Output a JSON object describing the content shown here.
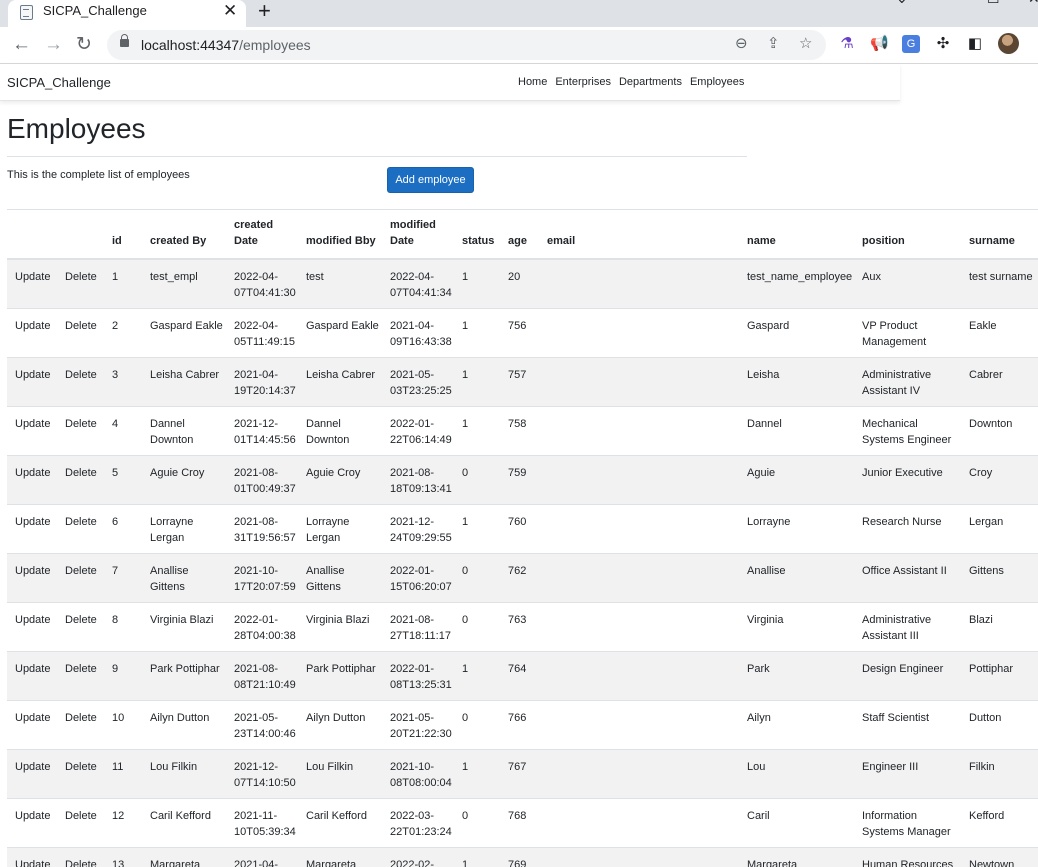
{
  "browser": {
    "tab_title": "SICPA_Challenge",
    "url_host": "localhost:44347",
    "url_path": "/employees"
  },
  "navbar": {
    "brand": "SICPA_Challenge",
    "links": [
      "Home",
      "Enterprises",
      "Departments",
      "Employees"
    ]
  },
  "page": {
    "title": "Employees",
    "intro": "This is the complete list of employees",
    "add_button": "Add employee"
  },
  "table": {
    "headers": {
      "update": "",
      "delete": "",
      "id": "id",
      "created_by": "created By",
      "created_date": "created Date",
      "modified_by": "modified Bby",
      "modified_date": "modified Date",
      "status": "status",
      "age": "age",
      "email": "email",
      "name": "name",
      "position": "position",
      "surname": "surname"
    },
    "action_update": "Update",
    "action_delete": "Delete",
    "rows": [
      {
        "id": "1",
        "created_by": "test_empl",
        "created_date": "2022-04-07T04:41:30",
        "modified_by": "test",
        "modified_date": "2022-04-07T04:41:34",
        "status": "1",
        "age": "20",
        "email": "",
        "name": "test_name_employee",
        "position": "Aux",
        "surname": "test surname"
      },
      {
        "id": "2",
        "created_by": "Gaspard Eakle",
        "created_date": "2022-04-05T11:49:15",
        "modified_by": "Gaspard Eakle",
        "modified_date": "2021-04-09T16:43:38",
        "status": "1",
        "age": "756",
        "email": "",
        "name": "Gaspard",
        "position": "VP Product Management",
        "surname": "Eakle"
      },
      {
        "id": "3",
        "created_by": "Leisha Cabrer",
        "created_date": "2021-04-19T20:14:37",
        "modified_by": "Leisha Cabrer",
        "modified_date": "2021-05-03T23:25:25",
        "status": "1",
        "age": "757",
        "email": "",
        "name": "Leisha",
        "position": "Administrative Assistant IV",
        "surname": "Cabrer"
      },
      {
        "id": "4",
        "created_by": "Dannel Downton",
        "created_date": "2021-12-01T14:45:56",
        "modified_by": "Dannel Downton",
        "modified_date": "2022-01-22T06:14:49",
        "status": "1",
        "age": "758",
        "email": "",
        "name": "Dannel",
        "position": "Mechanical Systems Engineer",
        "surname": "Downton"
      },
      {
        "id": "5",
        "created_by": "Aguie Croy",
        "created_date": "2021-08-01T00:49:37",
        "modified_by": "Aguie Croy",
        "modified_date": "2021-08-18T09:13:41",
        "status": "0",
        "age": "759",
        "email": "",
        "name": "Aguie",
        "position": "Junior Executive",
        "surname": "Croy"
      },
      {
        "id": "6",
        "created_by": "Lorrayne Lergan",
        "created_date": "2021-08-31T19:56:57",
        "modified_by": "Lorrayne Lergan",
        "modified_date": "2021-12-24T09:29:55",
        "status": "1",
        "age": "760",
        "email": "",
        "name": "Lorrayne",
        "position": "Research Nurse",
        "surname": "Lergan"
      },
      {
        "id": "7",
        "created_by": "Anallise Gittens",
        "created_date": "2021-10-17T20:07:59",
        "modified_by": "Anallise Gittens",
        "modified_date": "2022-01-15T06:20:07",
        "status": "0",
        "age": "762",
        "email": "",
        "name": "Anallise",
        "position": "Office Assistant II",
        "surname": "Gittens"
      },
      {
        "id": "8",
        "created_by": "Virginia Blazi",
        "created_date": "2022-01-28T04:00:38",
        "modified_by": "Virginia Blazi",
        "modified_date": "2021-08-27T18:11:17",
        "status": "0",
        "age": "763",
        "email": "",
        "name": "Virginia",
        "position": "Administrative Assistant III",
        "surname": "Blazi"
      },
      {
        "id": "9",
        "created_by": "Park Pottiphar",
        "created_date": "2021-08-08T21:10:49",
        "modified_by": "Park Pottiphar",
        "modified_date": "2022-01-08T13:25:31",
        "status": "1",
        "age": "764",
        "email": "",
        "name": "Park",
        "position": "Design Engineer",
        "surname": "Pottiphar"
      },
      {
        "id": "10",
        "created_by": "Ailyn Dutton",
        "created_date": "2021-05-23T14:00:46",
        "modified_by": "Ailyn Dutton",
        "modified_date": "2021-05-20T21:22:30",
        "status": "0",
        "age": "766",
        "email": "",
        "name": "Ailyn",
        "position": "Staff Scientist",
        "surname": "Dutton"
      },
      {
        "id": "11",
        "created_by": "Lou Filkin",
        "created_date": "2021-12-07T14:10:50",
        "modified_by": "Lou Filkin",
        "modified_date": "2021-10-08T08:00:04",
        "status": "1",
        "age": "767",
        "email": "",
        "name": "Lou",
        "position": "Engineer III",
        "surname": "Filkin"
      },
      {
        "id": "12",
        "created_by": "Caril Kefford",
        "created_date": "2021-11-10T05:39:34",
        "modified_by": "Caril Kefford",
        "modified_date": "2022-03-22T01:23:24",
        "status": "0",
        "age": "768",
        "email": "",
        "name": "Caril",
        "position": "Information Systems Manager",
        "surname": "Kefford"
      },
      {
        "id": "13",
        "created_by": "Margareta",
        "created_date": "2021-04-",
        "modified_by": "Margareta",
        "modified_date": "2022-02-",
        "status": "1",
        "age": "769",
        "email": "",
        "name": "Margareta",
        "position": "Human Resources",
        "surname": "Newtown"
      }
    ]
  },
  "colors": {
    "primary_button": "#1b6ec2",
    "row_stripe": "#f2f2f2",
    "tabstrip": "#dee1e6"
  },
  "icons": [
    "document-icon",
    "close-icon",
    "plus-icon",
    "back-arrow-icon",
    "forward-arrow-icon",
    "reload-icon",
    "lock-icon",
    "zoom-icon",
    "share-icon",
    "star-icon",
    "flask-icon",
    "megaphone-icon",
    "translate-icon",
    "puzzle-icon",
    "sidepanel-icon"
  ]
}
